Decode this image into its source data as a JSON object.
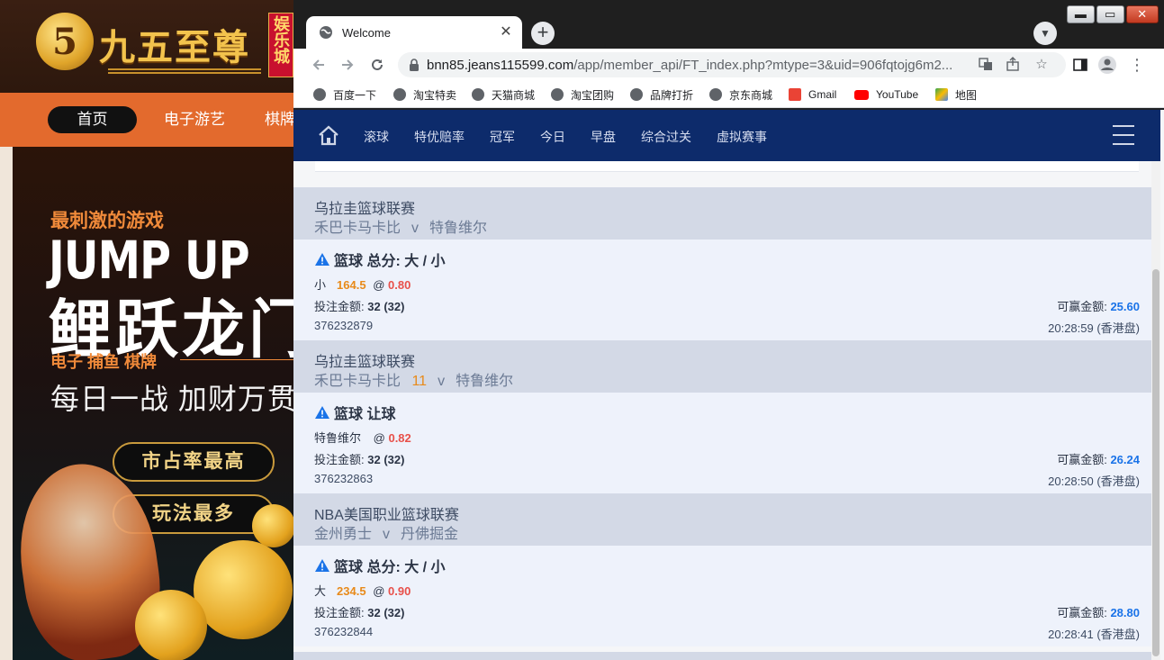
{
  "background_site": {
    "logo_text": "九五至尊",
    "logo_badge": "娱乐城",
    "nav": {
      "home": "首页",
      "items": [
        "电子游艺",
        "棋牌"
      ]
    },
    "hero": {
      "tagline": "最刺激的游戏",
      "headline_en": "JUMP UP",
      "headline_cn": "鲤跃龙门",
      "categories": "电子  捕鱼  棋牌",
      "slogan": "每日一战  加财万贯",
      "pill_1": "市占率最高",
      "pill_2": "玩法最多"
    }
  },
  "browser": {
    "tab_title": "Welcome",
    "url_host": "bnn85.jeans115599.com",
    "url_rest": "/app/member_api/FT_index.php?mtype=3&uid=906fqtojg6m2...",
    "bookmarks": [
      "百度一下",
      "淘宝特卖",
      "天猫商城",
      "淘宝团购",
      "品牌打折",
      "京东商城",
      "Gmail",
      "YouTube",
      "地图"
    ]
  },
  "app": {
    "nav": [
      "滚球",
      "特优赔率",
      "冠军",
      "今日",
      "早盘",
      "综合过关",
      "虚拟赛事"
    ],
    "bets": [
      {
        "league": "乌拉圭篮球联赛",
        "home": "禾巴卡马卡比",
        "score": "",
        "vs": "v",
        "away": "特鲁维尔",
        "type": "篮球 总分: 大 / 小",
        "pick": "小",
        "line": "164.5",
        "at": "@",
        "odds": "0.80",
        "stake_label": "投注金额:",
        "stake": "32 (32)",
        "win_label": "可赢金额:",
        "win": "25.60",
        "id": "376232879",
        "time": "20:28:59 (香港盘)"
      },
      {
        "league": "乌拉圭篮球联赛",
        "home": "禾巴卡马卡比",
        "score": "11",
        "vs": "v",
        "away": "特鲁维尔",
        "type": "篮球 让球",
        "pick": "特鲁维尔",
        "line": "",
        "at": "@",
        "odds": "0.82",
        "stake_label": "投注金额:",
        "stake": "32 (32)",
        "win_label": "可赢金额:",
        "win": "26.24",
        "id": "376232863",
        "time": "20:28:50 (香港盘)"
      },
      {
        "league": "NBA美国职业篮球联赛",
        "home": "金州勇士",
        "score": "",
        "vs": "v",
        "away": "丹佛掘金",
        "type": "篮球 总分: 大 / 小",
        "pick": "大",
        "line": "234.5",
        "at": "@",
        "odds": "0.90",
        "stake_label": "投注金额:",
        "stake": "32 (32)",
        "win_label": "可赢金额:",
        "win": "28.80",
        "id": "376232844",
        "time": "20:28:41 (香港盘)"
      }
    ]
  },
  "colors": {
    "app_nav_bg": "#0d2b6b",
    "league_bg": "#d3d9e6",
    "bet_bg": "#eef2fb",
    "line_orange": "#e88a1a",
    "odds_red": "#e8504a",
    "win_blue": "#1a73e8",
    "site_orange": "#e36a2d"
  }
}
